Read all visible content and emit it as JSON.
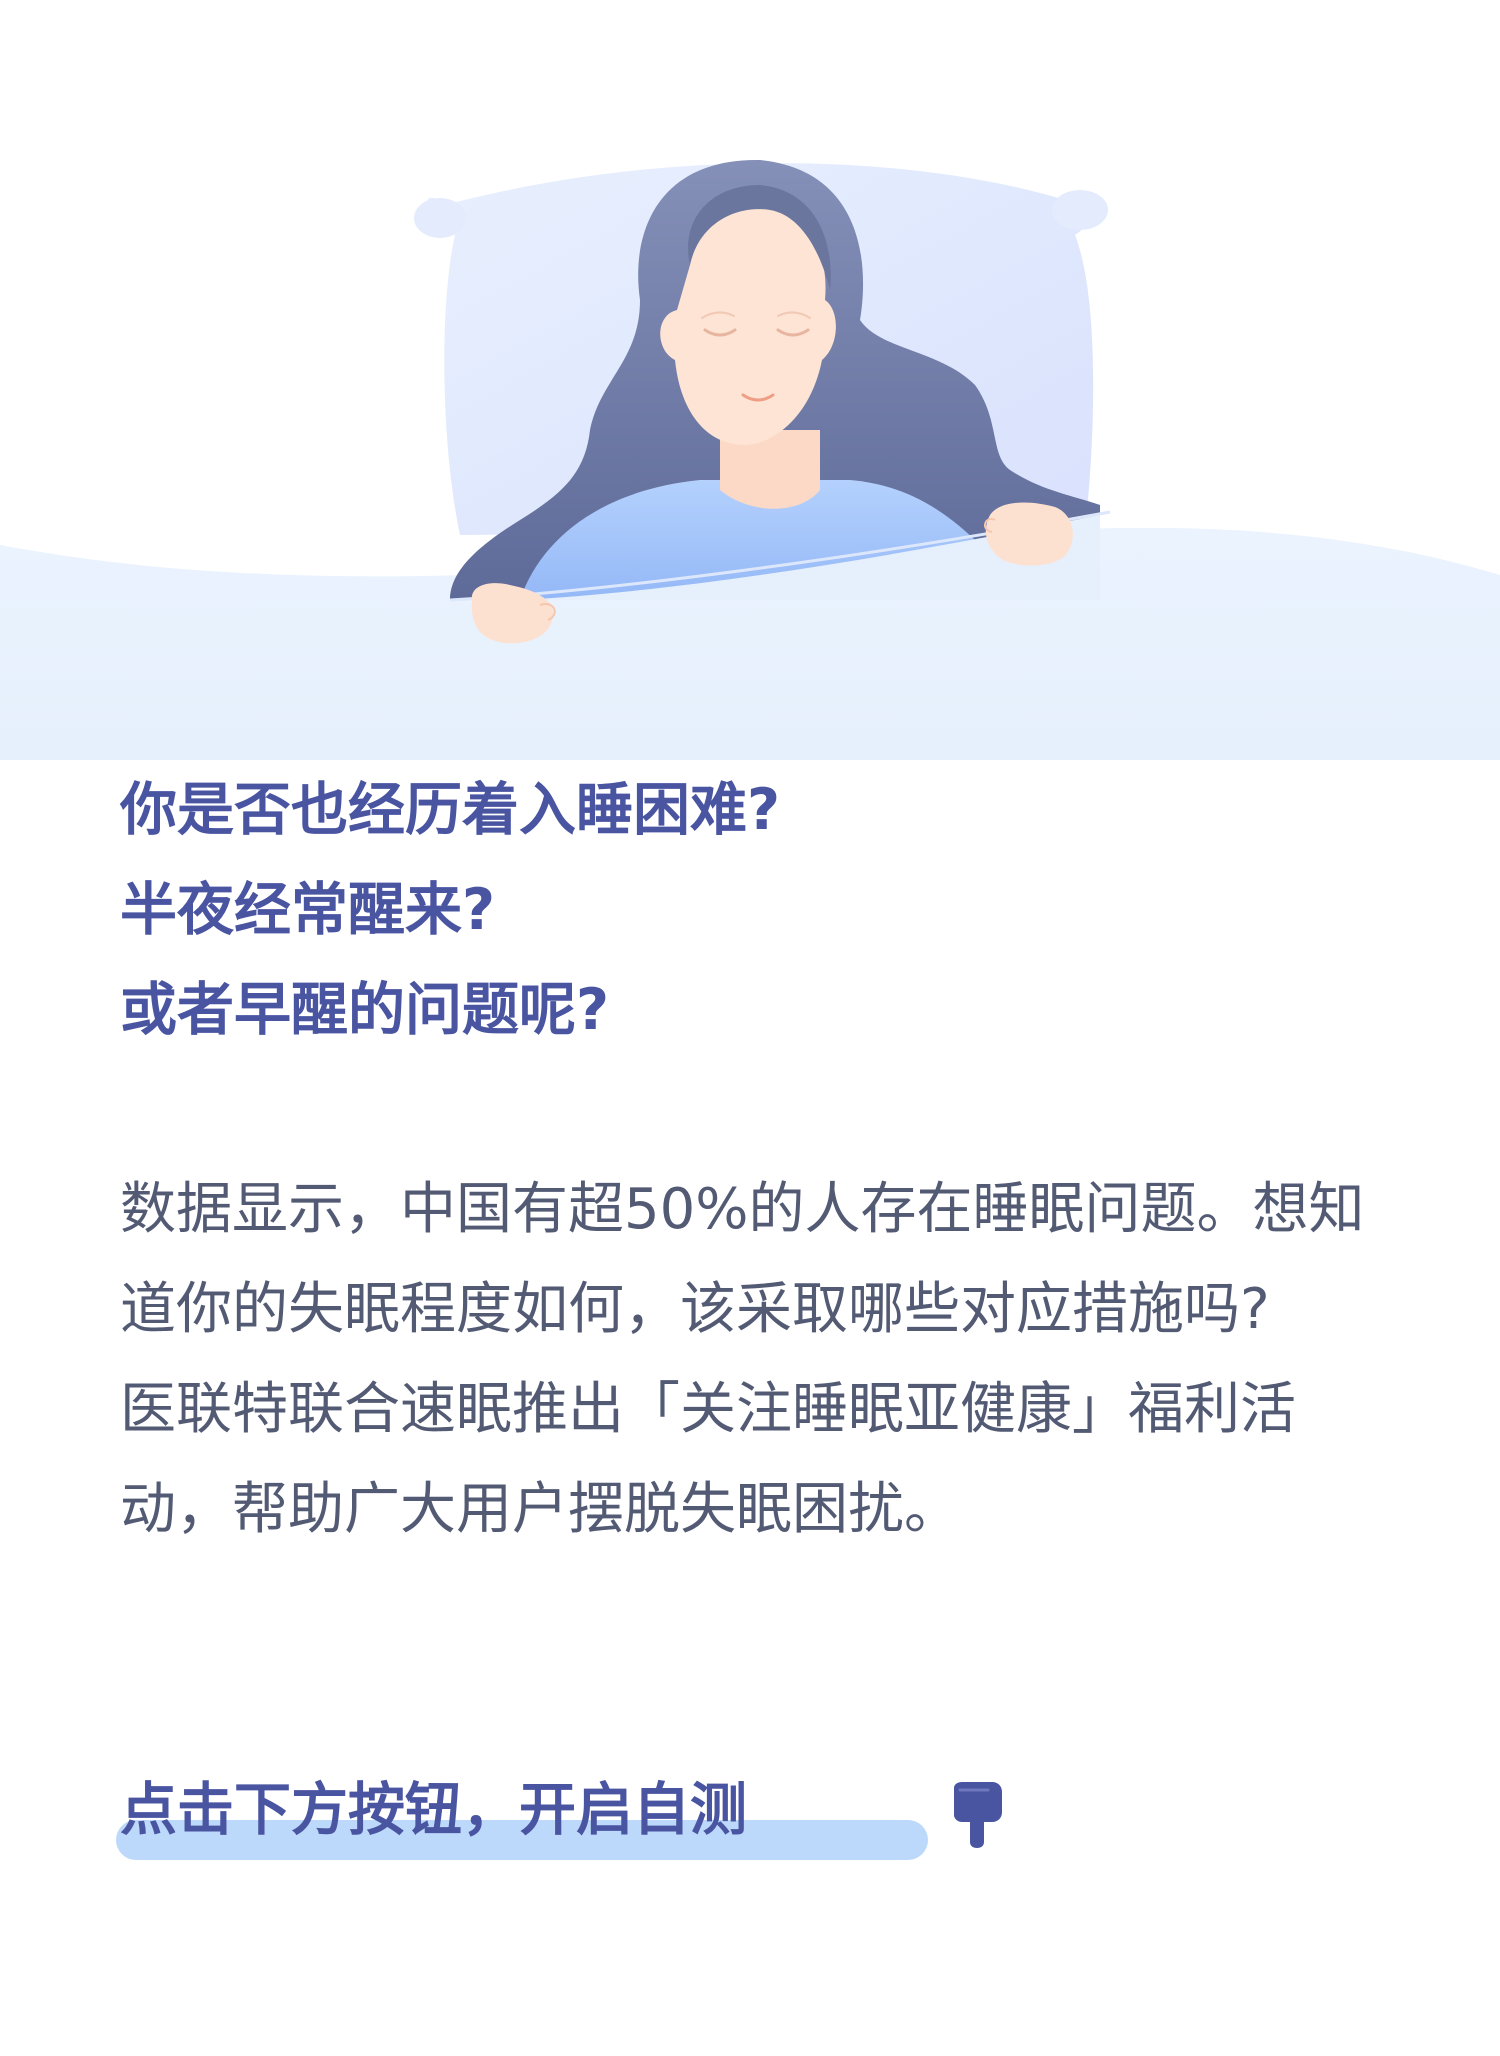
{
  "questions": [
    "你是否也经历着入睡困难?",
    "半夜经常醒来?",
    "或者早醒的问题呢?"
  ],
  "paragraphs": [
    "数据显示，中国有超50%的人存在睡眠问题。想知道你的失眠程度如何，该采取哪些对应措施吗?",
    "医联特联合速眠推出「关注睡眠亚健康」福利活动，帮助广大用户摆脱失眠困扰。"
  ],
  "cta": {
    "label": "点击下方按钮，开启自测"
  },
  "icons": {
    "hero": "sleeping-woman-illustration",
    "cta": "pointing-down-hand-icon"
  },
  "colors": {
    "heading": "#4a55a2",
    "body_text": "#535a73",
    "background_top": "#ffffff",
    "background_bottom": "#e6f0fc",
    "highlight": "#bcd8fa",
    "hair": "#6f7aa6",
    "shirt": "#a6c6fb",
    "skin": "#fde4d4",
    "pillow": "#e0e8fd"
  }
}
